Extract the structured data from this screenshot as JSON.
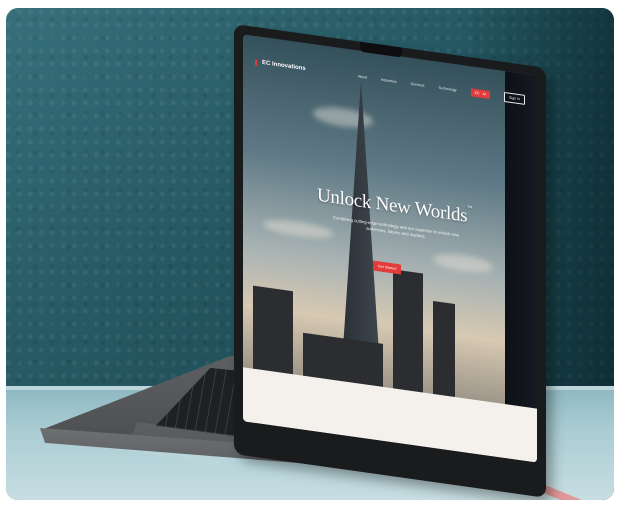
{
  "site": {
    "logo_text": "EC Innovations",
    "nav": [
      "About",
      "Industries",
      "Services",
      "Technology"
    ],
    "nav_cta": "EC · AI",
    "nav_outline": "Sign in"
  },
  "hero": {
    "title": "Unlock New Worlds",
    "trademark": "™",
    "subtitle": "Combining cutting-edge technology and our expertise to unlock new audiences, futures and markets.",
    "button": "Get Started"
  },
  "colors": {
    "accent": "#e23b3b",
    "wall": "#1f5560",
    "ledge": "#a9ccd3",
    "laptop": "#46484b"
  }
}
